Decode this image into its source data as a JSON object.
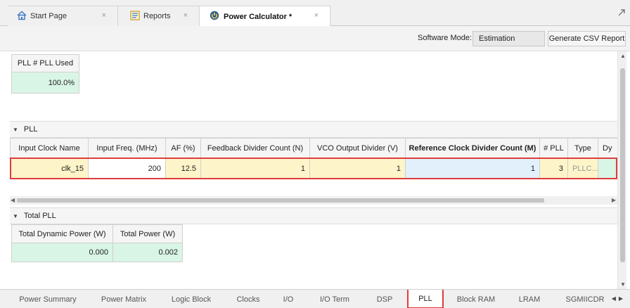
{
  "doc_tabs": [
    {
      "label": "Start Page",
      "close": "×",
      "icon": "home-icon"
    },
    {
      "label": "Reports",
      "close": "×",
      "icon": "report-icon"
    },
    {
      "label": "Power Calculator *",
      "close": "×",
      "icon": "power-calculator-icon"
    }
  ],
  "toolbar": {
    "software_mode_label": "Software Mode:",
    "software_mode_value": "Estimation",
    "csv_button": "Generate CSV Report"
  },
  "pll_used": {
    "header": "PLL # PLL Used",
    "value": "100.0%"
  },
  "pll_section": {
    "title": "PLL",
    "columns": [
      "Input Clock Name",
      "Input Freq. (MHz)",
      "AF (%)",
      "Feedback Divider Count (N)",
      "VCO Output Divider (V)",
      "Reference Clock Divider Count (M)",
      "# PLL",
      "Type",
      "Dy"
    ],
    "row": [
      "clk_15",
      "200",
      "12.5",
      "1",
      "1",
      "1",
      "3",
      "PLLC...",
      ""
    ]
  },
  "total_section": {
    "title": "Total PLL",
    "columns": [
      "Total Dynamic Power (W)",
      "Total Power (W)"
    ],
    "row": [
      "0.000",
      "0.002"
    ]
  },
  "bottom_tabs": [
    "Power Summary",
    "Power Matrix",
    "Logic Block",
    "Clocks",
    "I/O",
    "I/O Term",
    "DSP",
    "PLL",
    "Block RAM",
    "LRAM",
    "SGMIICDR"
  ],
  "active_bottom_tab": "PLL",
  "colors": {
    "calc_green": "#d9f5e6",
    "input_yellow": "#fdf5c9",
    "edit_blue": "#e2f0fb",
    "selection_red": "#e03c3c"
  }
}
